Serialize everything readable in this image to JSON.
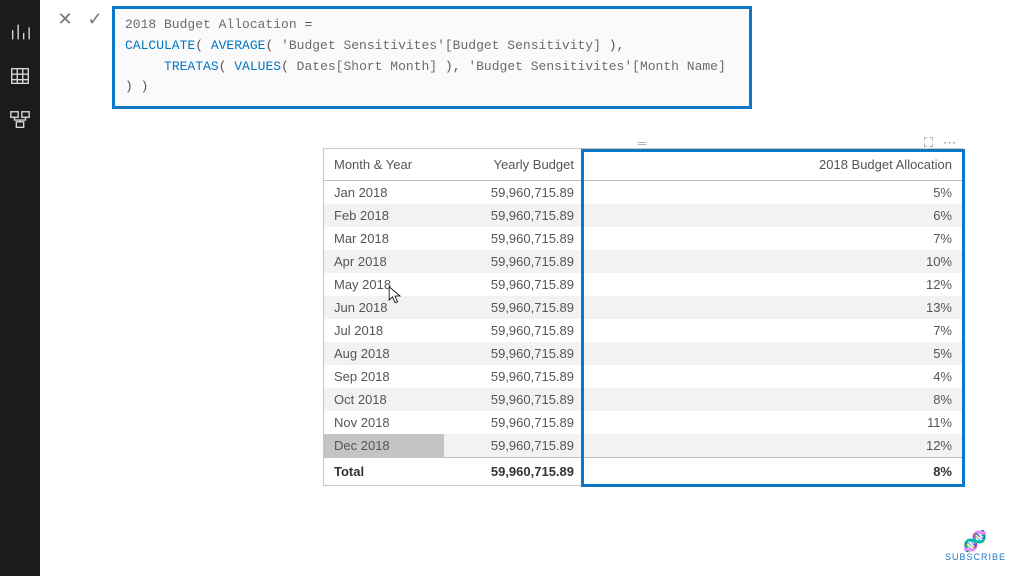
{
  "formula": {
    "name": "2018 Budget Allocation",
    "line1_kw1": "CALCULATE",
    "line1_kw2": "AVERAGE",
    "line1_txt": "'Budget Sensitivites'[Budget Sensitivity]",
    "line2_kw1": "TREATAS",
    "line2_kw2": "VALUES",
    "line2_txt1": "Dates[Short Month]",
    "line2_txt2": "'Budget Sensitivites'[Month Name]"
  },
  "table": {
    "headers": {
      "month": "Month & Year",
      "budget": "Yearly Budget",
      "alloc": "2018 Budget Allocation"
    },
    "rows": [
      {
        "month": "Jan 2018",
        "budget": "59,960,715.89",
        "alloc": "5%"
      },
      {
        "month": "Feb 2018",
        "budget": "59,960,715.89",
        "alloc": "6%"
      },
      {
        "month": "Mar 2018",
        "budget": "59,960,715.89",
        "alloc": "7%"
      },
      {
        "month": "Apr 2018",
        "budget": "59,960,715.89",
        "alloc": "10%"
      },
      {
        "month": "May 2018",
        "budget": "59,960,715.89",
        "alloc": "12%"
      },
      {
        "month": "Jun 2018",
        "budget": "59,960,715.89",
        "alloc": "13%"
      },
      {
        "month": "Jul 2018",
        "budget": "59,960,715.89",
        "alloc": "7%"
      },
      {
        "month": "Aug 2018",
        "budget": "59,960,715.89",
        "alloc": "5%"
      },
      {
        "month": "Sep 2018",
        "budget": "59,960,715.89",
        "alloc": "4%"
      },
      {
        "month": "Oct 2018",
        "budget": "59,960,715.89",
        "alloc": "8%"
      },
      {
        "month": "Nov 2018",
        "budget": "59,960,715.89",
        "alloc": "11%"
      },
      {
        "month": "Dec 2018",
        "budget": "59,960,715.89",
        "alloc": "12%"
      }
    ],
    "total": {
      "label": "Total",
      "budget": "59,960,715.89",
      "alloc": "8%"
    }
  },
  "watermark": {
    "label": "SUBSCRIBE"
  },
  "chart_data": {
    "type": "table",
    "title": "2018 Budget Allocation",
    "columns": [
      "Month & Year",
      "Yearly Budget",
      "2018 Budget Allocation"
    ],
    "rows": [
      [
        "Jan 2018",
        59960715.89,
        0.05
      ],
      [
        "Feb 2018",
        59960715.89,
        0.06
      ],
      [
        "Mar 2018",
        59960715.89,
        0.07
      ],
      [
        "Apr 2018",
        59960715.89,
        0.1
      ],
      [
        "May 2018",
        59960715.89,
        0.12
      ],
      [
        "Jun 2018",
        59960715.89,
        0.13
      ],
      [
        "Jul 2018",
        59960715.89,
        0.07
      ],
      [
        "Aug 2018",
        59960715.89,
        0.05
      ],
      [
        "Sep 2018",
        59960715.89,
        0.04
      ],
      [
        "Oct 2018",
        59960715.89,
        0.08
      ],
      [
        "Nov 2018",
        59960715.89,
        0.11
      ],
      [
        "Dec 2018",
        59960715.89,
        0.12
      ]
    ],
    "total": [
      "Total",
      59960715.89,
      0.08
    ]
  }
}
